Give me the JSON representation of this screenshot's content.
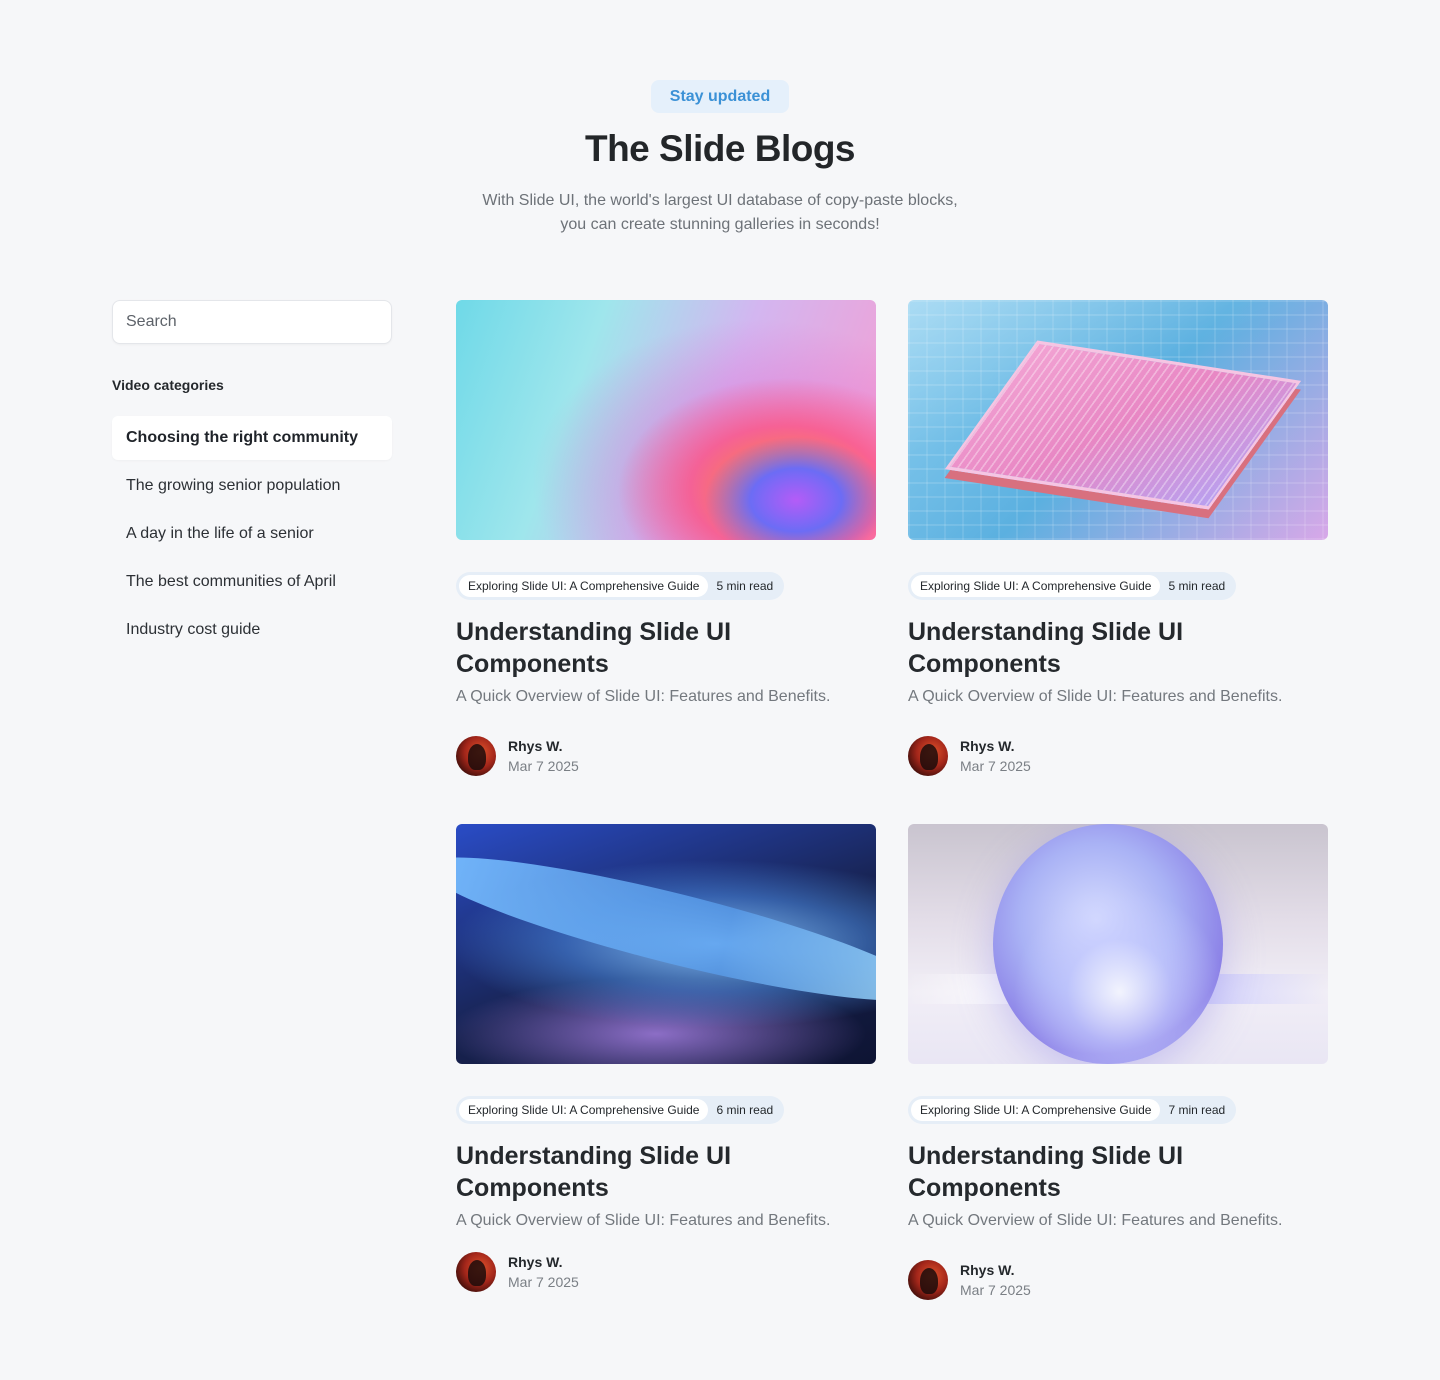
{
  "header": {
    "badge": "Stay updated",
    "title": "The Slide Blogs",
    "subtitle_line1": "With Slide UI, the world's largest UI database of copy-paste blocks,",
    "subtitle_line2": "you can create stunning galleries in seconds!"
  },
  "sidebar": {
    "search_placeholder": "Search",
    "categories_heading": "Video categories",
    "categories": [
      {
        "label": "Choosing the right community",
        "active": true
      },
      {
        "label": "The growing senior population",
        "active": false
      },
      {
        "label": "A day in the life of a senior",
        "active": false
      },
      {
        "label": "The best communities of April",
        "active": false
      },
      {
        "label": "Industry cost guide",
        "active": false
      }
    ]
  },
  "posts": [
    {
      "tag": "Exploring Slide UI: A Comprehensive Guide",
      "read": "5 min read",
      "title": "Understanding Slide UI Components",
      "desc": "A Quick Overview of Slide UI: Features and Benefits.",
      "author": "Rhys W.",
      "date": "Mar 7 2025"
    },
    {
      "tag": "Exploring Slide UI: A Comprehensive Guide",
      "read": "5 min read",
      "title": "Understanding Slide UI Components",
      "desc": "A Quick Overview of Slide UI: Features and Benefits.",
      "author": "Rhys W.",
      "date": "Mar 7 2025"
    },
    {
      "tag": "Exploring Slide UI: A Comprehensive Guide",
      "read": "6 min read",
      "title": "Understanding Slide UI Components",
      "desc": "A Quick Overview of Slide UI: Features and Benefits.",
      "author": "Rhys W.",
      "date": "Mar 7 2025"
    },
    {
      "tag": "Exploring Slide UI: A Comprehensive Guide",
      "read": "7 min read",
      "title": "Understanding Slide UI Components",
      "desc": "A Quick Overview of Slide UI: Features and Benefits.",
      "author": "Rhys W.",
      "date": "Mar 7 2025"
    }
  ],
  "colors": {
    "background": "#f6f7f9",
    "badge_bg": "#e5f0fb",
    "badge_text": "#3b91d6",
    "pill_bg": "#e6eef7"
  }
}
